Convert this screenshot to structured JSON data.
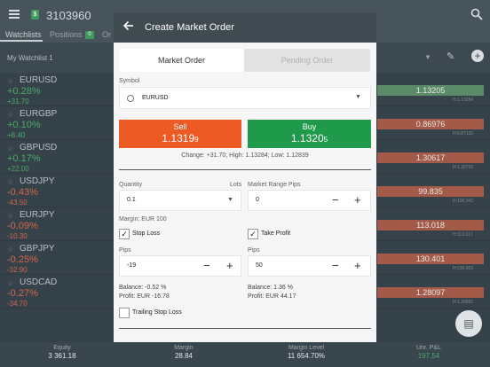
{
  "app": {
    "account_number": "3103960",
    "account_badge": "$",
    "tabs": [
      {
        "label": "Watchlists"
      },
      {
        "label": "Positions",
        "count": "0"
      },
      {
        "label": "Or"
      }
    ],
    "watchlist_title": "My Watchlist 1"
  },
  "watchlist": [
    {
      "symbol": "EURUSD",
      "change": "+0.28%",
      "points": "+31.70",
      "direction": "pos",
      "price": "1.13205",
      "bar": "up",
      "mini": "H:1.13284"
    },
    {
      "symbol": "EURGBP",
      "change": "+0.10%",
      "points": "+8.40",
      "direction": "pos",
      "price": "0.86976",
      "bar": "down",
      "mini": "H:0.87120"
    },
    {
      "symbol": "GBPUSD",
      "change": "+0.17%",
      "points": "+22.00",
      "direction": "pos",
      "price": "1.30617",
      "bar": "down",
      "mini": "H:1.30716"
    },
    {
      "symbol": "USDJPY",
      "change": "-0.43%",
      "points": "-43.50",
      "direction": "neg",
      "price": "99.835",
      "bar": "down",
      "mini": "H:100.342"
    },
    {
      "symbol": "EURJPY",
      "change": "-0.09%",
      "points": "-10.30",
      "direction": "neg",
      "price": "113.018",
      "bar": "down",
      "mini": "H:113.617"
    },
    {
      "symbol": "GBPJPY",
      "change": "-0.25%",
      "points": "-32.90",
      "direction": "neg",
      "price": "130.401",
      "bar": "down",
      "mini": "H:130.953"
    },
    {
      "symbol": "USDCAD",
      "change": "-0.27%",
      "points": "-34.70",
      "direction": "neg",
      "price": "1.28097",
      "bar": "down",
      "mini": "H:1.28561"
    }
  ],
  "footer": {
    "equity_label": "Equity",
    "equity_value": "3 361.18",
    "margin_label": "Margin",
    "margin_value": "28.84",
    "margin_level_label": "Margin Level",
    "margin_level_value": "11 654.70%",
    "unr_label": "Unr. P&L",
    "unr_value": "197.54"
  },
  "modal": {
    "title": "Create Market Order",
    "tab_market": "Market Order",
    "tab_pending": "Pending Order",
    "symbol_label": "Symbol",
    "symbol_value": "EURUSD",
    "sell_label": "Sell",
    "sell_price_main": "1.1319",
    "sell_price_pip": "9",
    "buy_label": "Buy",
    "buy_price_main": "1.1320",
    "buy_price_pip": "5",
    "change_line": "Change: +31.70; High: 1.13284; Low: 1.12839",
    "quantity_label": "Quantity",
    "lots_label": "Lots",
    "quantity_value": "0.1",
    "range_label": "Market Range Pips",
    "range_value": "0",
    "margin_line": "Margin:  EUR 100",
    "stop_loss_label": "Stop Loss",
    "take_profit_label": "Take Profit",
    "pips_label_left": "Pips",
    "pips_label_right": "Pips",
    "sl_pips": "-19",
    "tp_pips": "50",
    "sl_balance": "Balance:  -0.52 %",
    "sl_profit": "Profit:  EUR -16.78",
    "tp_balance": "Balance:  1.36 %",
    "tp_profit": "Profit:  EUR 44.17",
    "trailing_label": "Trailing Stop Loss"
  },
  "colors": {
    "sell": "#ee5a24",
    "buy": "#1e9a4a",
    "header": "#3f4a51"
  }
}
